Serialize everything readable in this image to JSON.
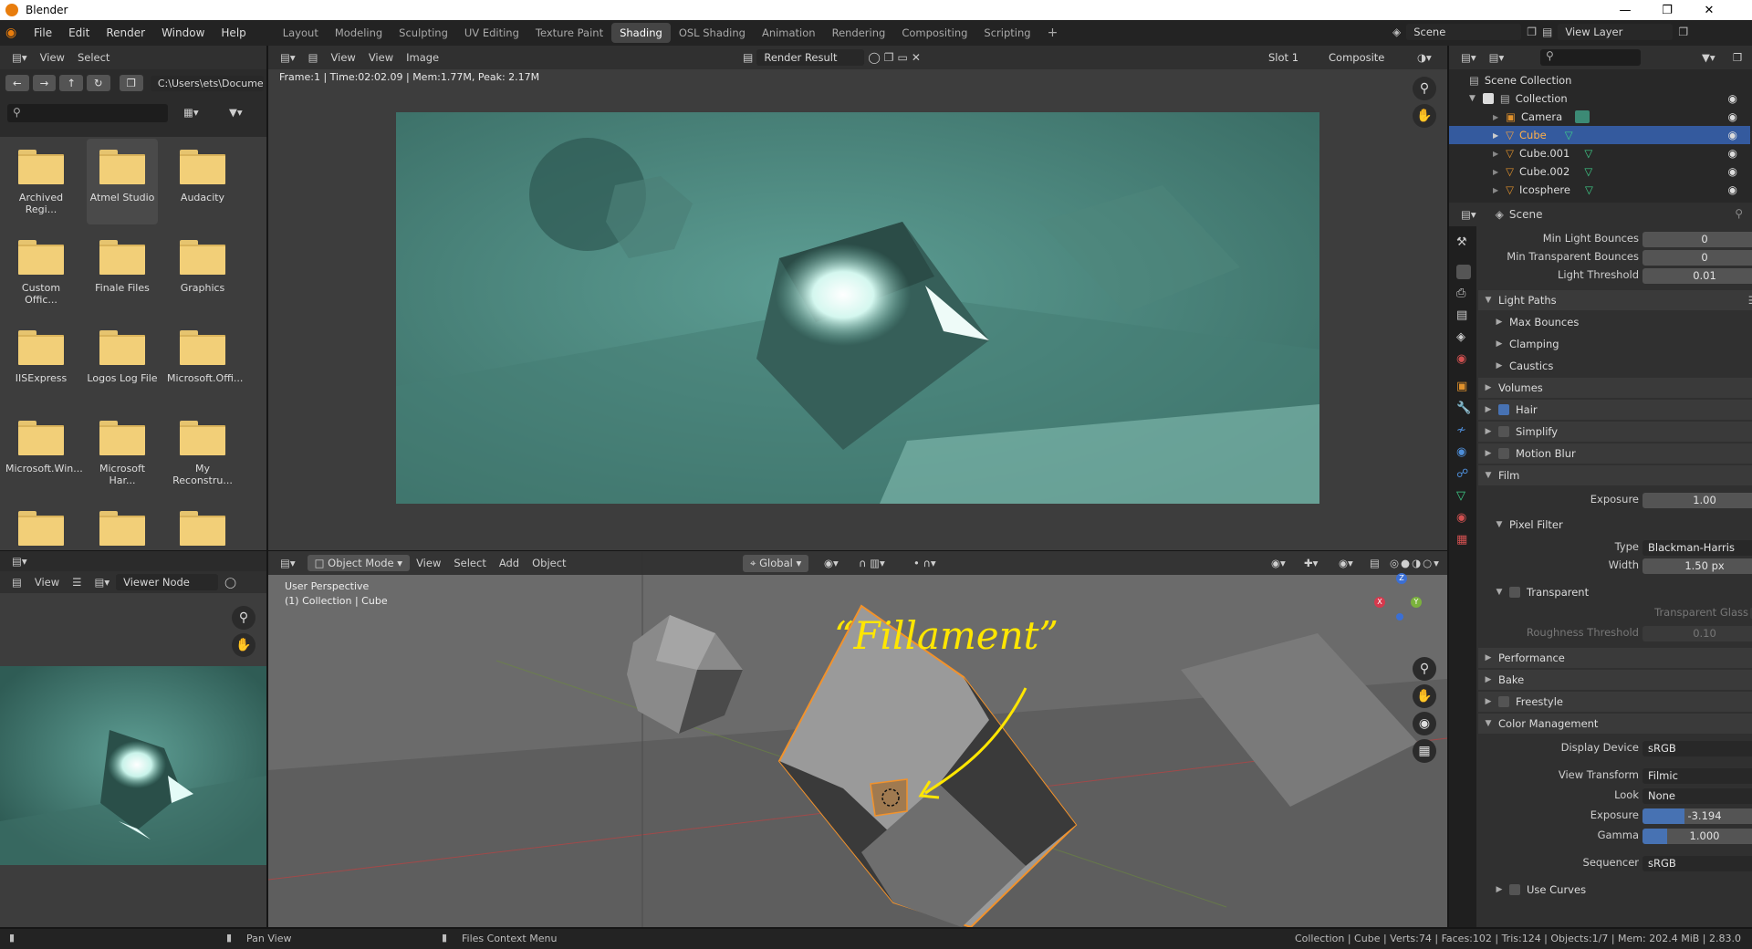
{
  "window": {
    "title": "Blender"
  },
  "menu": [
    "File",
    "Edit",
    "Render",
    "Window",
    "Help"
  ],
  "workspaces": [
    "Layout",
    "Modeling",
    "Sculpting",
    "UV Editing",
    "Texture Paint",
    "Shading",
    "OSL Shading",
    "Animation",
    "Rendering",
    "Compositing",
    "Scripting"
  ],
  "active_workspace": "Shading",
  "scene": {
    "name": "Scene",
    "view_layer": "View Layer"
  },
  "file_browser": {
    "view_label": "View",
    "select_label": "Select",
    "path": "C:\\Users\\ets\\Documen...",
    "folders": [
      "Archived Regi...",
      "Atmel Studio",
      "Audacity",
      "Custom Offic...",
      "Finale Files",
      "Graphics",
      "IISExpress",
      "Logos Log File",
      "Microsoft.Offi...",
      "Microsoft.Win...",
      "Microsoft Har...",
      "My Reconstru..."
    ],
    "selected": "Atmel Studio"
  },
  "image_editor": {
    "view_label": "View",
    "view_menu": "View",
    "image_menu": "Image",
    "image_name": "Render Result",
    "slot": "Slot 1",
    "pass": "Composite",
    "info": "Frame:1 | Time:02:02.09 | Mem:1.77M, Peak: 2.17M"
  },
  "viewer_node": {
    "view_label": "View",
    "name": "Viewer Node"
  },
  "viewport": {
    "mode": "Object Mode",
    "menus": [
      "View",
      "Select",
      "Add",
      "Object"
    ],
    "orientation": "Global",
    "perspective": "User Perspective",
    "collection_info": "(1) Collection | Cube",
    "annotation": "“Fillament”",
    "axes": {
      "x": "X",
      "y": "Y",
      "z": "Z"
    }
  },
  "outliner": {
    "root": "Scene Collection",
    "collection": "Collection",
    "items": [
      "Camera",
      "Cube",
      "Cube.001",
      "Cube.002",
      "Icosphere"
    ],
    "selected": "Cube"
  },
  "properties": {
    "scene_label": "Scene",
    "min_light_bounces": {
      "label": "Min Light Bounces",
      "value": "0"
    },
    "min_transparent_bounces": {
      "label": "Min Transparent Bounces",
      "value": "0"
    },
    "light_threshold": {
      "label": "Light Threshold",
      "value": "0.01"
    },
    "light_paths": "Light Paths",
    "max_bounces": "Max Bounces",
    "clamping": "Clamping",
    "caustics": "Caustics",
    "volumes": "Volumes",
    "hair": "Hair",
    "simplify": "Simplify",
    "motion_blur": "Motion Blur",
    "film": "Film",
    "film_exposure": {
      "label": "Exposure",
      "value": "1.00"
    },
    "pixel_filter": "Pixel Filter",
    "filter_type": {
      "label": "Type",
      "value": "Blackman-Harris"
    },
    "filter_width": {
      "label": "Width",
      "value": "1.50 px"
    },
    "transparent": "Transparent",
    "transparent_glass": "Transparent Glass",
    "roughness_threshold": {
      "label": "Roughness Threshold",
      "value": "0.10"
    },
    "performance": "Performance",
    "bake": "Bake",
    "freestyle": "Freestyle",
    "color_management": "Color Management",
    "display_device": {
      "label": "Display Device",
      "value": "sRGB"
    },
    "view_transform": {
      "label": "View Transform",
      "value": "Filmic"
    },
    "look": {
      "label": "Look",
      "value": "None"
    },
    "cm_exposure": {
      "label": "Exposure",
      "value": "-3.194"
    },
    "gamma": {
      "label": "Gamma",
      "value": "1.000"
    },
    "sequencer": {
      "label": "Sequencer",
      "value": "sRGB"
    },
    "use_curves": "Use Curves"
  },
  "statusbar": {
    "pan_view": "Pan View",
    "files_context": "Files Context Menu",
    "stats": "Collection | Cube | Verts:74 | Faces:102 | Tris:124 | Objects:1/7 | Mem: 202.4 MiB | 2.83.0"
  }
}
